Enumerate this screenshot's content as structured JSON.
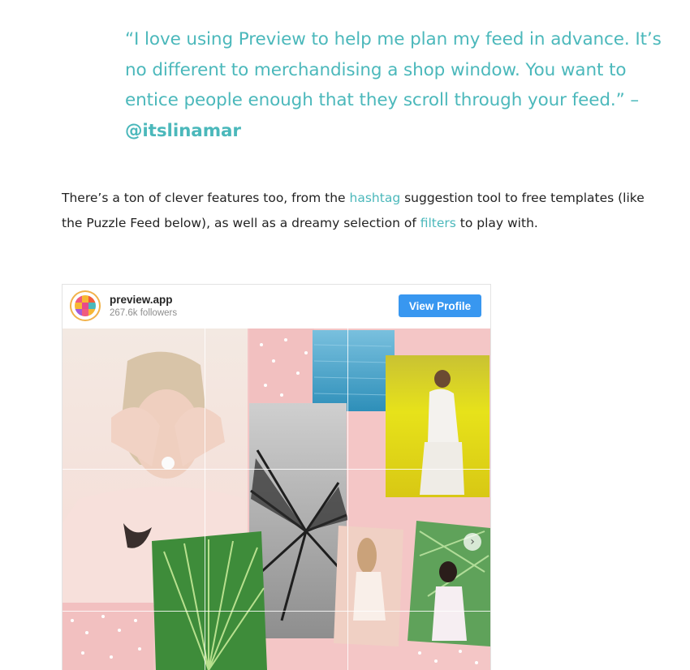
{
  "quote": {
    "text": "“I love using Preview to help me plan my feed in advance. It’s no different to merchandising a shop window. You want to entice people enough that they scroll through your feed.” –",
    "handle": "@itslinamar"
  },
  "paragraph": {
    "part1": "There’s a ton of clever features too, from the ",
    "link1": "hashtag",
    "part2": " suggestion tool to free templates (like the Puzzle Feed below), as well as a dreamy selection of ",
    "link2": "filters",
    "part3": " to play with."
  },
  "instagram_card": {
    "account_name": "preview.app",
    "followers": "267.6k followers",
    "view_profile_label": "View Profile",
    "next_icon": "chevron-right-icon",
    "colors": {
      "button": "#3897f0",
      "accent_text": "#4bb8bb",
      "grid_background": "#f4c6c6"
    }
  }
}
